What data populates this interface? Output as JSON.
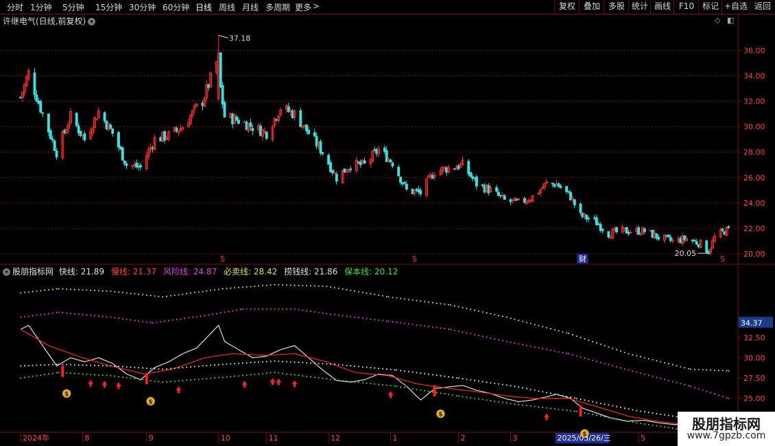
{
  "toolbar": {
    "periods": [
      "分时",
      "1分钟",
      "5分钟",
      "15分钟",
      "30分钟",
      "60分钟",
      "日线",
      "周线",
      "月线",
      "多周期",
      "更多"
    ],
    "active_period": "日线",
    "more_arrow": ">",
    "buttons": [
      "复权",
      "叠加",
      "多股",
      "统计",
      "画线",
      "F10",
      "标记",
      "+自选",
      "返回"
    ]
  },
  "stock_title": "许继电气(日线,前复权)",
  "indicator": {
    "name": "股朋指标网",
    "lines": [
      {
        "label": "快线:",
        "value": "21.89",
        "color": "#e0e0e0"
      },
      {
        "label": "慢线:",
        "value": "21.37",
        "color": "#ff4040"
      },
      {
        "label": "风险线:",
        "value": "24.87",
        "color": "#e040e0"
      },
      {
        "label": "必卖线:",
        "value": "28.42",
        "color": "#e0e040"
      },
      {
        "label": "捞钱线:",
        "value": "21.86",
        "color": "#e0e0e0"
      },
      {
        "label": "保本线:",
        "value": "20.12",
        "color": "#40e040"
      }
    ],
    "current_tag": "34.37"
  },
  "colors": {
    "up": "#ff3030",
    "down": "#39e1e1",
    "grid": "#7a1010",
    "axis_text": "#ff4040"
  },
  "markers": {
    "high_label": "37.18",
    "low_label": "20.05",
    "s_markers": [
      {
        "date": "2024-10-10",
        "text": "S"
      },
      {
        "date": "2025-01-14",
        "text": "S"
      },
      {
        "date": "2025-06-17",
        "text": "S"
      }
    ],
    "cai_marker": {
      "date": "2025-04-08",
      "text": "财"
    }
  },
  "watermark": {
    "line1": "股朋指标网",
    "line2": "www.7gpzb.com"
  },
  "chart_data": [
    {
      "type": "candlestick",
      "title": "许继电气(日线,前复权)",
      "ylim": [
        19.3,
        37.8
      ],
      "y_ticks": [
        "36.00",
        "34.00",
        "32.00",
        "30.00",
        "28.00",
        "26.00",
        "24.00",
        "22.00",
        "20.00"
      ],
      "x_ticks": [
        "2024年",
        "8",
        "9",
        "10",
        "11",
        "12",
        "1",
        "2",
        "3",
        "2025/03/26/三",
        "5",
        "6"
      ],
      "close_anchors": [
        {
          "date": "2024-07-01",
          "close": 32.3
        },
        {
          "date": "2024-07-05",
          "close": 34.2
        },
        {
          "date": "2024-07-12",
          "close": 31.0
        },
        {
          "date": "2024-07-19",
          "close": 28.0
        },
        {
          "date": "2024-07-26",
          "close": 30.8
        },
        {
          "date": "2024-08-02",
          "close": 29.0
        },
        {
          "date": "2024-08-09",
          "close": 31.2
        },
        {
          "date": "2024-08-16",
          "close": 29.5
        },
        {
          "date": "2024-08-23",
          "close": 27.0
        },
        {
          "date": "2024-08-30",
          "close": 26.8
        },
        {
          "date": "2024-09-06",
          "close": 29.0
        },
        {
          "date": "2024-09-13",
          "close": 29.3
        },
        {
          "date": "2024-09-20",
          "close": 30.0
        },
        {
          "date": "2024-09-27",
          "close": 31.5
        },
        {
          "date": "2024-09-30",
          "close": 32.0
        },
        {
          "date": "2024-10-08",
          "close": 35.5
        },
        {
          "date": "2024-10-09",
          "close": 33.0
        },
        {
          "date": "2024-10-11",
          "close": 30.8
        },
        {
          "date": "2024-10-18",
          "close": 30.5
        },
        {
          "date": "2024-10-25",
          "close": 30.0
        },
        {
          "date": "2024-11-01",
          "close": 29.5
        },
        {
          "date": "2024-11-08",
          "close": 31.5
        },
        {
          "date": "2024-11-15",
          "close": 31.0
        },
        {
          "date": "2024-11-22",
          "close": 29.5
        },
        {
          "date": "2024-11-29",
          "close": 28.0
        },
        {
          "date": "2024-12-06",
          "close": 26.0
        },
        {
          "date": "2024-12-13",
          "close": 27.0
        },
        {
          "date": "2024-12-20",
          "close": 27.0
        },
        {
          "date": "2024-12-27",
          "close": 28.2
        },
        {
          "date": "2025-01-03",
          "close": 27.2
        },
        {
          "date": "2025-01-10",
          "close": 25.0
        },
        {
          "date": "2025-01-17",
          "close": 24.8
        },
        {
          "date": "2025-01-24",
          "close": 26.5
        },
        {
          "date": "2025-02-07",
          "close": 27.0
        },
        {
          "date": "2025-02-14",
          "close": 25.5
        },
        {
          "date": "2025-02-21",
          "close": 25.0
        },
        {
          "date": "2025-02-28",
          "close": 24.2
        },
        {
          "date": "2025-03-07",
          "close": 24.0
        },
        {
          "date": "2025-03-14",
          "close": 24.5
        },
        {
          "date": "2025-03-21",
          "close": 25.5
        },
        {
          "date": "2025-03-26",
          "close": 25.5
        },
        {
          "date": "2025-04-02",
          "close": 24.5
        },
        {
          "date": "2025-04-07",
          "close": 23.0
        },
        {
          "date": "2025-04-14",
          "close": 22.6
        },
        {
          "date": "2025-04-21",
          "close": 21.6
        },
        {
          "date": "2025-04-28",
          "close": 21.8
        },
        {
          "date": "2025-05-09",
          "close": 21.8
        },
        {
          "date": "2025-05-16",
          "close": 21.3
        },
        {
          "date": "2025-05-23",
          "close": 21.0
        },
        {
          "date": "2025-05-30",
          "close": 21.2
        },
        {
          "date": "2025-06-06",
          "close": 20.8
        },
        {
          "date": "2025-06-10",
          "close": 20.2
        },
        {
          "date": "2025-06-13",
          "close": 21.3
        },
        {
          "date": "2025-06-18",
          "close": 21.8
        },
        {
          "date": "2025-06-20",
          "close": 21.9
        }
      ]
    },
    {
      "type": "line",
      "title": "股朋指标网",
      "ylim": [
        21.0,
        40.0
      ],
      "y_ticks": [
        "32.50",
        "30.00",
        "27.50",
        "25.00",
        "22.50"
      ],
      "series": [
        {
          "name": "快线",
          "color": "#e0e0e0",
          "dotted": false,
          "points": [
            [
              "2024-07-01",
              33.5
            ],
            [
              "2024-07-05",
              34.0
            ],
            [
              "2024-07-12",
              31.5
            ],
            [
              "2024-07-19",
              29.0
            ],
            [
              "2024-07-26",
              30.0
            ],
            [
              "2024-08-02",
              29.5
            ],
            [
              "2024-08-09",
              30.0
            ],
            [
              "2024-08-16",
              29.3
            ],
            [
              "2024-08-23",
              28.0
            ],
            [
              "2024-08-30",
              27.3
            ],
            [
              "2024-09-06",
              28.8
            ],
            [
              "2024-09-13",
              29.5
            ],
            [
              "2024-09-20",
              30.5
            ],
            [
              "2024-09-27",
              31.2
            ],
            [
              "2024-10-08",
              34.0
            ],
            [
              "2024-10-11",
              32.0
            ],
            [
              "2024-10-18",
              31.0
            ],
            [
              "2024-10-25",
              30.0
            ],
            [
              "2024-11-01",
              30.2
            ],
            [
              "2024-11-08",
              31.0
            ],
            [
              "2024-11-15",
              31.5
            ],
            [
              "2024-11-22",
              30.0
            ],
            [
              "2024-11-29",
              28.5
            ],
            [
              "2024-12-06",
              27.2
            ],
            [
              "2024-12-13",
              27.0
            ],
            [
              "2024-12-20",
              27.3
            ],
            [
              "2024-12-27",
              28.0
            ],
            [
              "2025-01-03",
              27.8
            ],
            [
              "2025-01-10",
              26.5
            ],
            [
              "2025-01-17",
              24.8
            ],
            [
              "2025-01-24",
              26.2
            ],
            [
              "2025-02-07",
              26.6
            ],
            [
              "2025-02-14",
              26.0
            ],
            [
              "2025-02-21",
              25.6
            ],
            [
              "2025-02-28",
              25.0
            ],
            [
              "2025-03-07",
              24.6
            ],
            [
              "2025-03-14",
              24.8
            ],
            [
              "2025-03-21",
              25.2
            ],
            [
              "2025-03-26",
              25.5
            ],
            [
              "2025-04-02",
              25.0
            ],
            [
              "2025-04-08",
              23.8
            ],
            [
              "2025-04-15",
              23.2
            ],
            [
              "2025-04-22",
              22.6
            ],
            [
              "2025-04-30",
              22.2
            ],
            [
              "2025-05-09",
              22.3
            ],
            [
              "2025-05-16",
              22.0
            ],
            [
              "2025-05-23",
              21.8
            ],
            [
              "2025-05-30",
              21.7
            ],
            [
              "2025-06-06",
              21.5
            ],
            [
              "2025-06-12",
              21.4
            ]
          ]
        },
        {
          "name": "慢线",
          "color": "#ff2020",
          "dotted": false,
          "points": [
            [
              "2024-07-01",
              33.5
            ],
            [
              "2024-07-15",
              31.5
            ],
            [
              "2024-08-01",
              30.0
            ],
            [
              "2024-08-15",
              29.0
            ],
            [
              "2024-09-01",
              28.0
            ],
            [
              "2024-09-15",
              28.6
            ],
            [
              "2024-10-01",
              30.0
            ],
            [
              "2024-10-15",
              30.5
            ],
            [
              "2024-11-01",
              30.3
            ],
            [
              "2024-11-15",
              30.5
            ],
            [
              "2024-12-01",
              29.5
            ],
            [
              "2024-12-15",
              28.2
            ],
            [
              "2025-01-01",
              27.8
            ],
            [
              "2025-01-15",
              26.8
            ],
            [
              "2025-02-01",
              26.2
            ],
            [
              "2025-02-15",
              25.8
            ],
            [
              "2025-03-01",
              25.3
            ],
            [
              "2025-03-15",
              25.0
            ],
            [
              "2025-04-01",
              25.0
            ],
            [
              "2025-04-15",
              24.0
            ],
            [
              "2025-05-01",
              22.8
            ],
            [
              "2025-05-15",
              22.2
            ],
            [
              "2025-06-01",
              21.7
            ],
            [
              "2025-06-12",
              21.4
            ]
          ]
        },
        {
          "name": "风险线",
          "color": "#e040e0",
          "dotted": true,
          "points": [
            [
              "2024-07-01",
              35.0
            ],
            [
              "2024-07-20",
              35.6
            ],
            [
              "2024-08-15",
              35.0
            ],
            [
              "2024-09-05",
              34.3
            ],
            [
              "2024-10-01",
              35.2
            ],
            [
              "2024-10-20",
              36.0
            ],
            [
              "2024-11-15",
              36.0
            ],
            [
              "2024-12-05",
              35.3
            ],
            [
              "2025-01-01",
              34.5
            ],
            [
              "2025-02-01",
              33.5
            ],
            [
              "2025-03-01",
              32.0
            ],
            [
              "2025-04-01",
              30.5
            ],
            [
              "2025-05-01",
              28.5
            ],
            [
              "2025-06-01",
              26.5
            ],
            [
              "2025-06-20",
              25.0
            ]
          ]
        },
        {
          "name": "必卖线",
          "color": "#e0e040",
          "dotted": true,
          "points": [
            [
              "2024-07-01",
              38.0
            ],
            [
              "2024-07-20",
              38.5
            ],
            [
              "2024-08-15",
              38.2
            ],
            [
              "2024-09-10",
              37.5
            ],
            [
              "2024-10-10",
              38.5
            ],
            [
              "2024-11-05",
              39.0
            ],
            [
              "2024-12-01",
              38.8
            ],
            [
              "2025-01-01",
              37.5
            ],
            [
              "2025-02-01",
              36.5
            ],
            [
              "2025-03-01",
              35.0
            ],
            [
              "2025-04-01",
              33.0
            ],
            [
              "2025-05-01",
              30.5
            ],
            [
              "2025-06-01",
              28.6
            ],
            [
              "2025-06-20",
              28.4
            ]
          ]
        },
        {
          "name": "捞钱线",
          "color": "#e0e0e0",
          "dotted": true,
          "points": [
            [
              "2024-07-01",
              29.0
            ],
            [
              "2024-07-20",
              29.2
            ],
            [
              "2024-08-15",
              29.0
            ],
            [
              "2024-09-10",
              28.6
            ],
            [
              "2024-10-10",
              29.2
            ],
            [
              "2024-11-05",
              29.6
            ],
            [
              "2024-12-05",
              29.2
            ],
            [
              "2025-01-05",
              28.5
            ],
            [
              "2025-02-05",
              27.5
            ],
            [
              "2025-03-05",
              26.5
            ],
            [
              "2025-04-05",
              25.0
            ],
            [
              "2025-05-05",
              23.5
            ],
            [
              "2025-06-01",
              22.5
            ],
            [
              "2025-06-20",
              21.9
            ]
          ]
        },
        {
          "name": "保本线",
          "color": "#40e040",
          "dotted": true,
          "points": [
            [
              "2024-07-01",
              27.5
            ],
            [
              "2024-07-20",
              28.2
            ],
            [
              "2024-08-15",
              27.8
            ],
            [
              "2024-09-10",
              27.0
            ],
            [
              "2024-10-10",
              27.6
            ],
            [
              "2024-11-05",
              28.2
            ],
            [
              "2024-12-05",
              27.3
            ],
            [
              "2025-01-05",
              26.5
            ],
            [
              "2025-02-05",
              25.3
            ],
            [
              "2025-03-05",
              24.3
            ],
            [
              "2025-04-05",
              23.4
            ],
            [
              "2025-05-05",
              22.0
            ],
            [
              "2025-06-01",
              21.0
            ],
            [
              "2025-06-20",
              20.1
            ]
          ]
        }
      ],
      "buy_arrows": [
        "2024-08-05",
        "2024-08-12",
        "2024-08-19",
        "2024-09-18",
        "2024-10-21",
        "2024-11-04",
        "2024-11-07",
        "2024-11-15",
        "2025-01-02",
        "2025-03-21"
      ],
      "sell_bars": [
        "2024-07-22",
        "2024-09-02",
        "2025-01-24",
        "2025-04-07"
      ],
      "money_bags": [
        "2024-07-24",
        "2024-09-04",
        "2025-01-27",
        "2025-04-09"
      ]
    }
  ]
}
